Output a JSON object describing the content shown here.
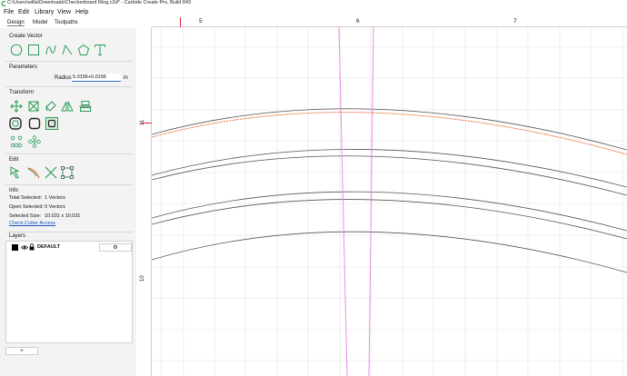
{
  "window": {
    "title": "C:\\Users\\willa\\Downloads\\Checkerboard Ring.c2d* - Carbide Create Pro, Build 843",
    "accent": "#2a9d57"
  },
  "menu": {
    "file": "File",
    "edit": "Edit",
    "view": "View",
    "library": "Library",
    "help": "Help"
  },
  "tabs": {
    "design": "Design",
    "model": "Model",
    "toolpaths": "Toolpaths"
  },
  "sidebar": {
    "create_vector": {
      "header": "Create Vector",
      "tools": [
        "circle-icon",
        "rectangle-icon",
        "curve-icon",
        "polyline-icon",
        "polygon-icon",
        "text-icon"
      ]
    },
    "parameters": {
      "header": "Parameters",
      "radius_label": "Radius",
      "radius_value": "5.0156+0.0156",
      "unit": "in"
    },
    "transform": {
      "header": "Transform",
      "tools": [
        "move-icon",
        "scale-icon",
        "rotate-icon",
        "flip-icon",
        "align-icon",
        "offset-icon",
        "fillet-icon",
        "boolean-icon",
        "array-icon",
        "circular-array-icon"
      ]
    },
    "edit": {
      "header": "Edit",
      "tools": [
        "node-edit-icon",
        "knife-icon",
        "cut-icon",
        "bounds-icon"
      ]
    },
    "info": {
      "header": "Info",
      "total_selected_label": "Total Selected:",
      "total_selected_value": "1 Vectors",
      "open_selected_label": "Open Selected:",
      "open_selected_value": "0 Vectors",
      "selected_size_label": "Selected Size:",
      "selected_size_value": "10.031 x 10.031",
      "check_cutter_link": "Check Cutter Access"
    },
    "layers": {
      "header": "Layers",
      "items": [
        {
          "name": "DEFAULT",
          "color": "#000000",
          "gear": "⚙"
        }
      ],
      "add_button": "+"
    }
  },
  "canvas": {
    "ruler_top_labels": [
      "5",
      "6",
      "7"
    ],
    "ruler_left_labels": [
      "11",
      "10"
    ],
    "selected_color": "#e8733a",
    "toolpath_color": "#e88ce8",
    "vector_color": "#666666"
  }
}
